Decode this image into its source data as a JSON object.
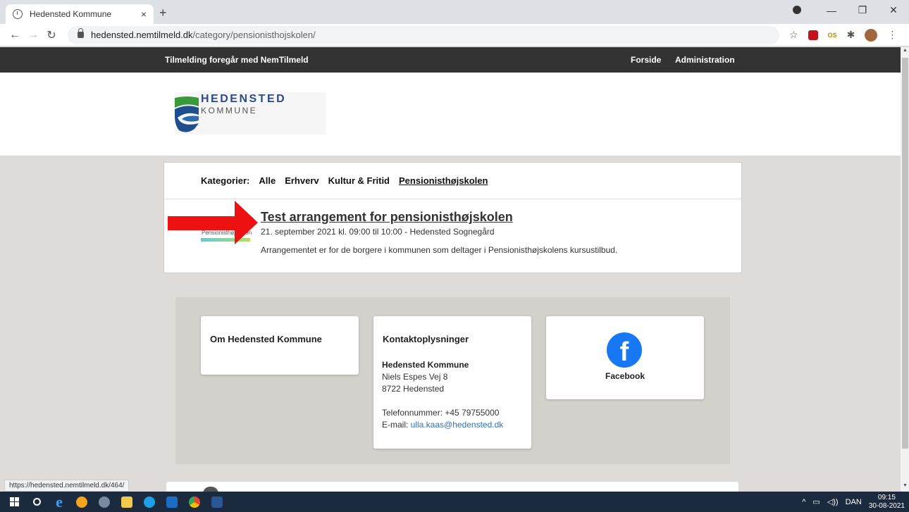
{
  "browser": {
    "tab_title": "Hedensted Kommune",
    "tab_close": "×",
    "new_tab": "+",
    "url_host": "hedensted.nemtilmeld.dk",
    "url_path": "/category/pensionisthojskolen/",
    "status_url": "https://hedensted.nemtilmeld.dk/464/"
  },
  "sitebar": {
    "left_text": "Tilmelding foregår med NemTilmeld",
    "nav_home": "Forside",
    "nav_admin": "Administration"
  },
  "logo": {
    "line1": "HEDENSTED",
    "line2": "KOMMUNE"
  },
  "categories": {
    "label": "Kategorier:",
    "items": [
      "Alle",
      "Erhverv",
      "Kultur & Fritid",
      "Pensionisthøjskolen"
    ],
    "active": "Pensionisthøjskolen"
  },
  "event": {
    "thumb_text": "Pensionisthøjskolen",
    "title": "Test arrangement for pensionisthøjskolen",
    "meta": "21. september 2021 kl. 09:00 til 10:00 - Hedensted Sognegård",
    "description": "Arrangementet er for de borgere i kommunen som deltager i Pensionisthøjskolens kursustilbud."
  },
  "footer": {
    "about_title": "Om Hedensted Kommune",
    "contact_title": "Kontaktoplysninger",
    "contact_name": "Hedensted Kommune",
    "contact_street": "Niels Espes Vej 8",
    "contact_city": "8722 Hedensted",
    "contact_phone": "Telefonnummer: +45 79755000",
    "contact_email_label": "E-mail: ",
    "contact_email": "ulla.kaas@hedensted.dk",
    "facebook_label": "Facebook"
  },
  "taskbar": {
    "lang": "DAN",
    "time": "09:15",
    "date": "30-08-2021"
  },
  "colors": {
    "sitebar": "#333333",
    "arrow": "#ee1111",
    "facebook": "#1877f2",
    "link": "#2a72c3"
  }
}
